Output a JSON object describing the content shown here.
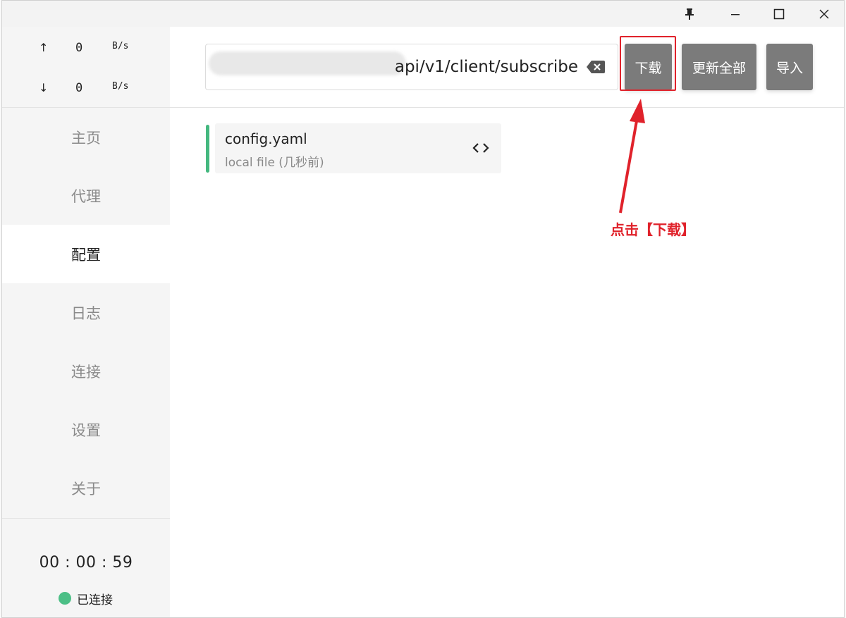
{
  "window": {
    "controls": {
      "pin_icon": "pin-icon",
      "minimize_icon": "minimize-icon",
      "maximize_icon": "maximize-icon",
      "close_icon": "close-icon"
    }
  },
  "traffic": {
    "upload": {
      "arrow": "↑",
      "value": "0",
      "unit": "B/s"
    },
    "download": {
      "arrow": "↓",
      "value": "0",
      "unit": "B/s"
    }
  },
  "sidebar": {
    "items": [
      {
        "label": "主页",
        "active": false
      },
      {
        "label": "代理",
        "active": false
      },
      {
        "label": "配置",
        "active": true
      },
      {
        "label": "日志",
        "active": false
      },
      {
        "label": "连接",
        "active": false
      },
      {
        "label": "设置",
        "active": false
      },
      {
        "label": "关于",
        "active": false
      }
    ],
    "timer": "00 : 00 : 59",
    "status": "已连接",
    "status_color": "#4cbf86"
  },
  "toolbar": {
    "url_value": "api/v1/client/subscribe",
    "download_label": "下载",
    "update_all_label": "更新全部",
    "import_label": "导入",
    "button_color": "#7b7b7b"
  },
  "profiles": [
    {
      "name": "config.yaml",
      "subtitle": "local file (几秒前)",
      "accent": "#44b87f"
    }
  ],
  "annotation": {
    "text": "点击【下载】",
    "color": "#e0222b"
  }
}
